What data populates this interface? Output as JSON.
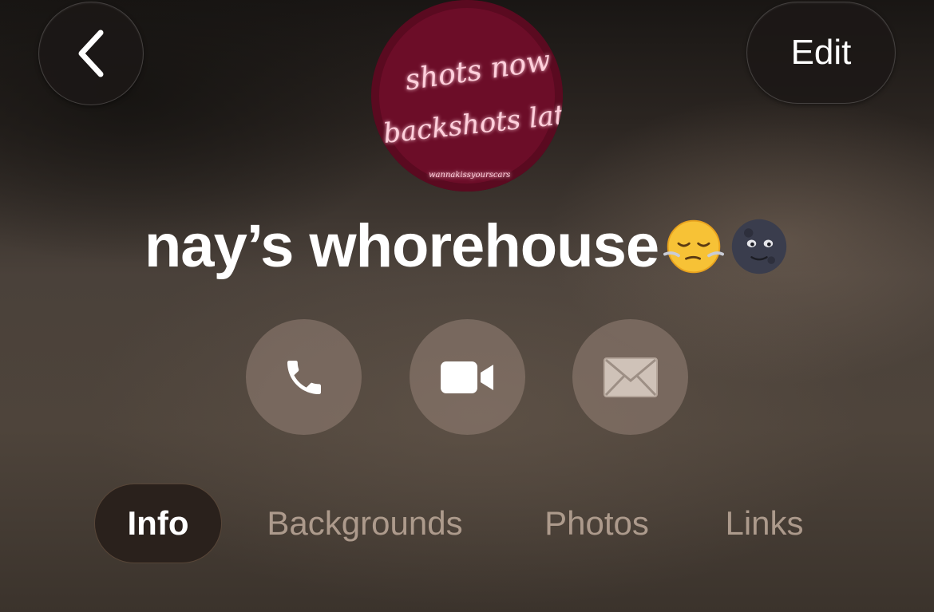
{
  "header": {
    "back_icon": "chevron-left-icon",
    "edit_label": "Edit"
  },
  "avatar": {
    "lines": [
      "shots now",
      "backshots later",
      "wannakissyourscars"
    ],
    "accent": "#ff4d7a"
  },
  "group": {
    "name": "nay’s whorehouse",
    "emojis": [
      "face-exhaling-emoji",
      "new-moon-face-emoji"
    ]
  },
  "actions": [
    {
      "icon": "phone-icon"
    },
    {
      "icon": "video-camera-icon"
    },
    {
      "icon": "envelope-icon"
    }
  ],
  "tabs": [
    {
      "label": "Info",
      "active": true
    },
    {
      "label": "Backgrounds",
      "active": false
    },
    {
      "label": "Photos",
      "active": false
    },
    {
      "label": "Links",
      "active": false
    }
  ]
}
